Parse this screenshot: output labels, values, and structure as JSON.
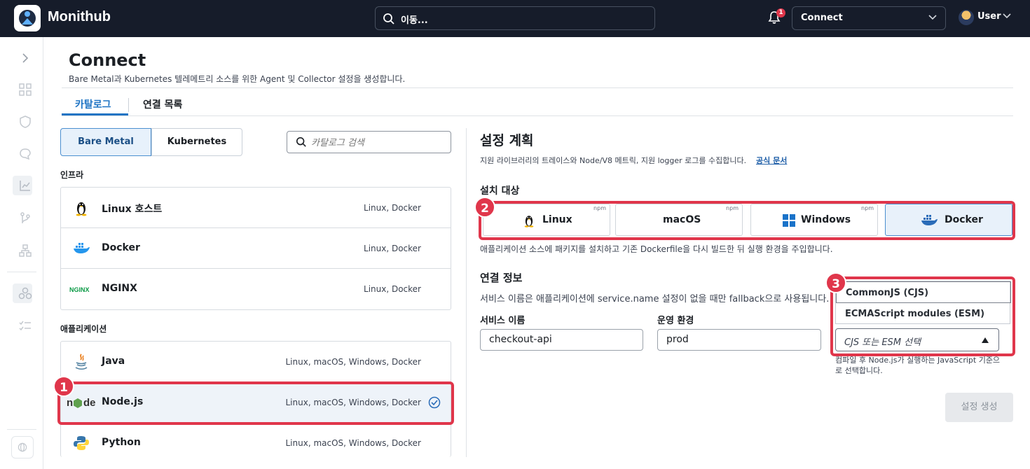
{
  "topbar": {
    "app_name": "Monithub",
    "search_text": "이동...",
    "notification_count": "1",
    "connect_select": "Connect",
    "user_name": "User"
  },
  "page": {
    "title": "Connect",
    "subtitle": "Bare Metal과 Kubernetes 텔레메트리 소스를 위한 Agent 및 Collector 설정을 생성합니다."
  },
  "tabs": [
    {
      "label": "카탈로그",
      "active": true
    },
    {
      "label": "연결 목록",
      "active": false
    }
  ],
  "segment": {
    "left": "Bare Metal",
    "right": "Kubernetes",
    "selected": "Bare Metal"
  },
  "catalog_search": {
    "placeholder": "카탈로그 검색"
  },
  "sections": {
    "infra": {
      "label": "인프라",
      "items": [
        {
          "name": "Linux 호스트",
          "meta": "Linux, Docker",
          "icon": "tux-icon"
        },
        {
          "name": "Docker",
          "meta": "Linux, Docker",
          "icon": "docker-icon"
        },
        {
          "name": "NGINX",
          "meta": "Linux, Docker",
          "icon": "nginx-icon"
        }
      ]
    },
    "apps": {
      "label": "애플리케이션",
      "items": [
        {
          "name": "Java",
          "meta": "Linux, macOS, Windows, Docker",
          "icon": "java-icon"
        },
        {
          "name": "Node.js",
          "meta": "Linux, macOS, Windows, Docker",
          "icon": "nodejs-icon",
          "selected": true
        },
        {
          "name": "Python",
          "meta": "Linux, macOS, Windows, Docker",
          "icon": "python-icon"
        }
      ]
    }
  },
  "plan": {
    "title": "설정 계획",
    "subtitle": "지원 라이브러리의 트레이스와 Node/V8 메트릭, 지원 logger 로그를 수집합니다.",
    "doc_link": "공식 문서",
    "install_target_label": "설치 대상",
    "platforms": [
      {
        "label": "Linux",
        "npm": "npm",
        "icon": "tux-icon"
      },
      {
        "label": "macOS",
        "npm": "npm",
        "icon": ""
      },
      {
        "label": "Windows",
        "npm": "npm",
        "icon": "windows-icon"
      },
      {
        "label": "Docker",
        "npm": "",
        "icon": "docker-icon",
        "selected": true
      }
    ],
    "platform_note": "애플리케이션 소스에 패키지를 설치하고 기존 Dockerfile을 다시 빌드한 뒤 실행 환경을 주입합니다.",
    "conn_title": "연결 정보",
    "conn_note": "서비스 이름은 애플리케이션에 service.name 설정이 없을 때만 fallback으로 사용됩니다.",
    "service_name_label": "서비스 이름",
    "service_name_value": "checkout-api",
    "env_label": "운영 환경",
    "env_value": "prod",
    "module_options": [
      "CommonJS (CJS)",
      "ECMAScript modules (ESM)"
    ],
    "module_placeholder": "CJS 또는 ESM 선택",
    "module_help": "컴파일 후 Node.js가 실행하는 JavaScript 기준으로 선택합니다.",
    "generate_button": "설정 생성"
  },
  "callouts": [
    "1",
    "2",
    "3"
  ],
  "colors": {
    "accent": "#1f74c4",
    "callout": "#e0364b",
    "topbar": "#161c2a"
  }
}
